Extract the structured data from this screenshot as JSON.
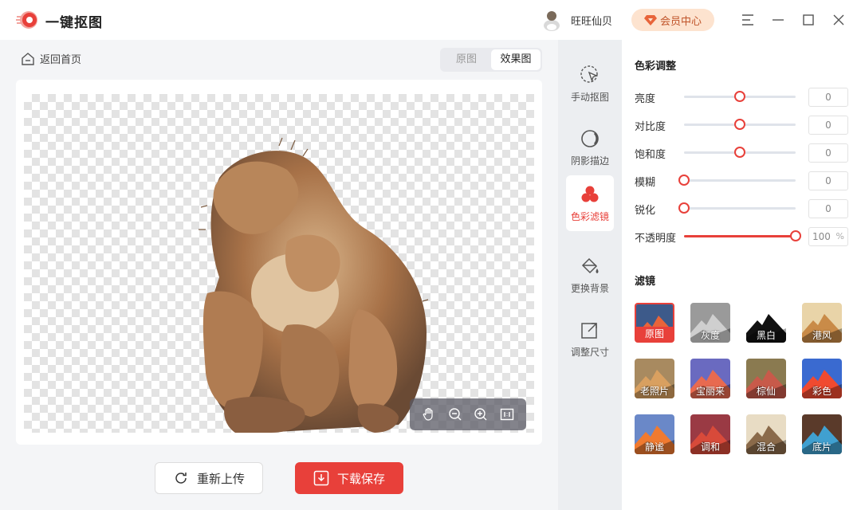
{
  "app": {
    "title": "一键抠图"
  },
  "user": {
    "name": "旺旺仙贝",
    "vip_label": "会员中心"
  },
  "nav": {
    "back_label": "返回首页"
  },
  "view_toggle": {
    "original": "原图",
    "effect": "效果图",
    "selected": "效果图"
  },
  "actions": {
    "reupload": "重新上传",
    "save": "下载保存"
  },
  "tools": [
    {
      "label": "手动抠图",
      "icon": "cursor-select-icon"
    },
    {
      "label": "阴影描边",
      "icon": "shadow-outline-icon"
    },
    {
      "label": "色彩滤镜",
      "icon": "color-filter-icon",
      "active": true
    },
    {
      "label": "更换背景",
      "icon": "paint-bucket-icon"
    },
    {
      "label": "调整尺寸",
      "icon": "resize-icon"
    }
  ],
  "color_adjust": {
    "title": "色彩调整",
    "sliders": [
      {
        "label": "亮度",
        "value": "0",
        "level": 0.5
      },
      {
        "label": "对比度",
        "value": "0",
        "level": 0.5
      },
      {
        "label": "饱和度",
        "value": "0",
        "level": 0.5
      },
      {
        "label": "模糊",
        "value": "0",
        "level": 0.0
      },
      {
        "label": "锐化",
        "value": "0",
        "level": 0.0
      },
      {
        "label": "不透明度",
        "value": "100",
        "unit": "%",
        "level": 1.0
      }
    ]
  },
  "filters": {
    "title": "滤镜",
    "items": [
      {
        "label": "原图",
        "selected": true,
        "sky": "#3d5a8a",
        "peak": "#e8643a"
      },
      {
        "label": "灰度",
        "sky": "#9a9a9a",
        "peak": "#cfcfcf"
      },
      {
        "label": "黑白",
        "sky": "#ffffff",
        "peak": "#111111"
      },
      {
        "label": "港风",
        "sky": "#e9d4a8",
        "peak": "#c98b48"
      },
      {
        "label": "老照片",
        "sky": "#a88a60",
        "peak": "#d9a060"
      },
      {
        "label": "宝丽来",
        "sky": "#6a6ac0",
        "peak": "#e86a50"
      },
      {
        "label": "棕仙",
        "sky": "#8a7a50",
        "peak": "#c85a4a"
      },
      {
        "label": "彩色",
        "sky": "#3a6ad0",
        "peak": "#f04a30"
      },
      {
        "label": "静谧",
        "sky": "#6a88c8",
        "peak": "#f07a30"
      },
      {
        "label": "调和",
        "sky": "#9a3a44",
        "peak": "#d84a3a"
      },
      {
        "label": "混合",
        "sky": "#e8dcc4",
        "peak": "#8a6a4a"
      },
      {
        "label": "底片",
        "sky": "#5a3a2a",
        "peak": "#40a0d0"
      }
    ]
  },
  "colors": {
    "accent": "#e8403a",
    "vip_bg": "#fde3cf"
  }
}
